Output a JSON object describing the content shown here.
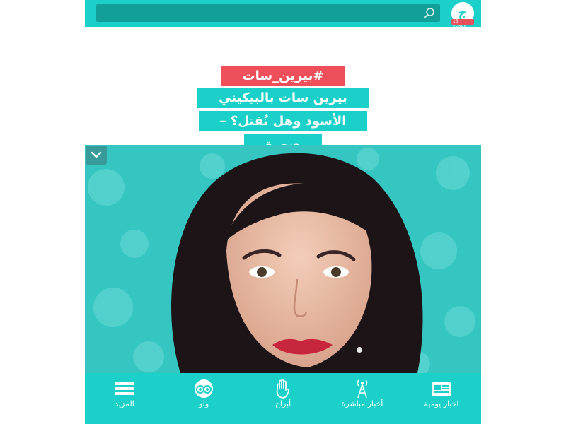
{
  "header": {
    "search_placeholder": "",
    "logo_glyph": "ج",
    "logo_badge": "15 YEARS"
  },
  "article": {
    "hashtag": "#بيرين_سات",
    "title_lines": [
      "بيرين سات بالبيكيني",
      "الأسود وهل تُقتل؟ –",
      "صورة"
    ]
  },
  "nav": {
    "items": [
      {
        "label": "اخبار يومية",
        "icon": "newspaper-icon"
      },
      {
        "label": "أخبار مباشرة",
        "icon": "broadcast-tower-icon"
      },
      {
        "label": "أبراج",
        "icon": "hand-icon"
      },
      {
        "label": "ولو",
        "icon": "owl-eyes-icon"
      },
      {
        "label": "المزيد",
        "icon": "menu-icon"
      }
    ]
  },
  "colors": {
    "brand": "#1bd0c8",
    "brand_dark": "#129f99",
    "accent": "#ef4f5a"
  }
}
